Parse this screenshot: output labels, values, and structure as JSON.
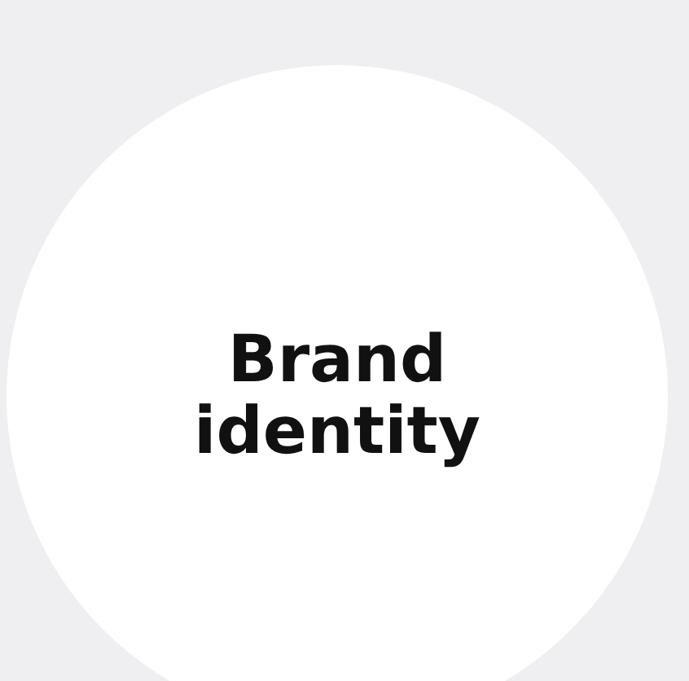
{
  "card": {
    "title": "Brand identity"
  }
}
